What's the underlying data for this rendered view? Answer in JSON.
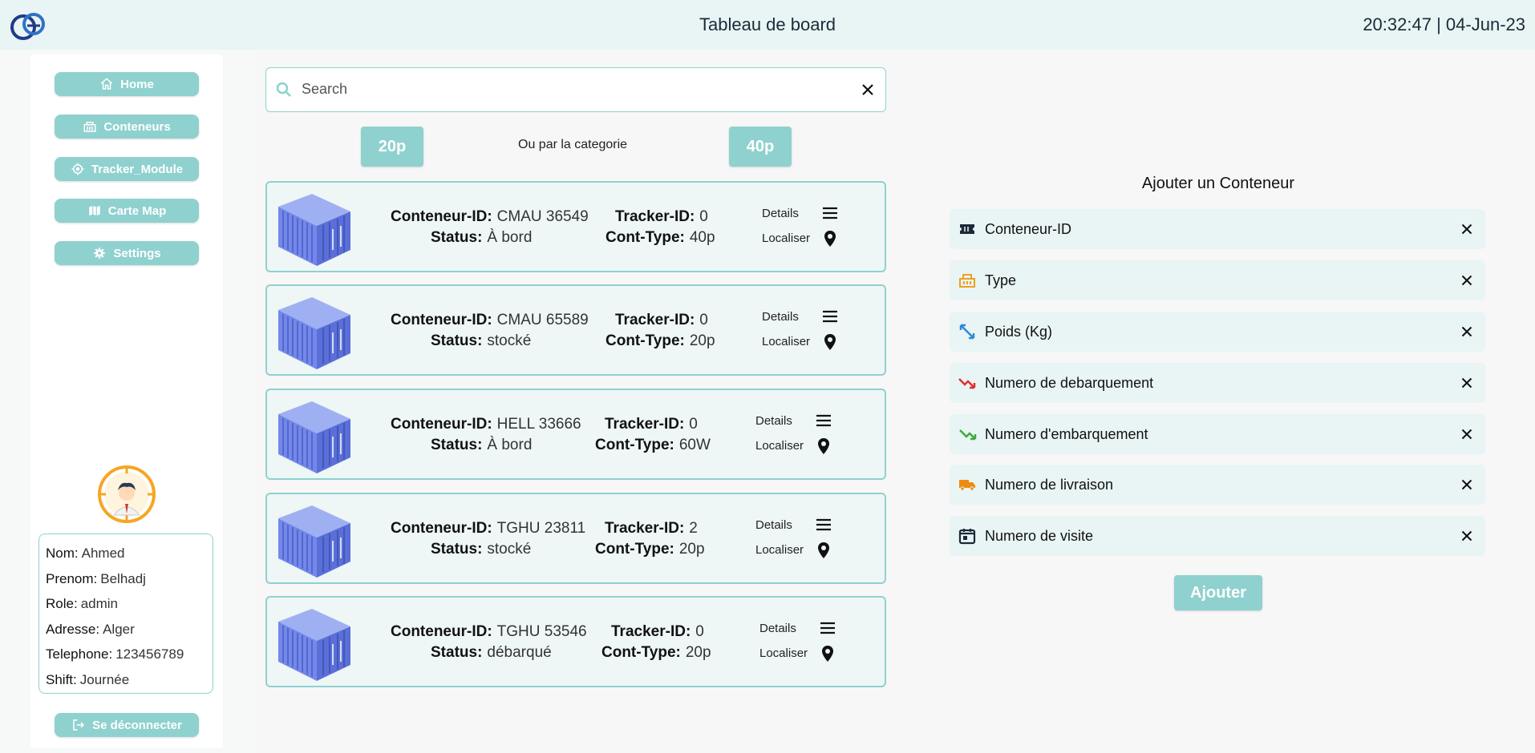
{
  "header": {
    "title": "Tableau de board",
    "time": "20:32:47",
    "separator": "|",
    "date": "04-Jun-23"
  },
  "sidebar": {
    "items": [
      {
        "label": "Home",
        "icon": "home-icon"
      },
      {
        "label": "Conteneurs",
        "icon": "container-icon"
      },
      {
        "label": "Tracker_Module",
        "icon": "tracker-icon"
      },
      {
        "label": "Carte Map",
        "icon": "map-icon"
      },
      {
        "label": "Settings",
        "icon": "gear-icon"
      }
    ],
    "profile": [
      {
        "key": "Nom:",
        "value": "Ahmed"
      },
      {
        "key": "Prenom:",
        "value": "Belhadj"
      },
      {
        "key": "Role:",
        "value": "admin"
      },
      {
        "key": "Adresse:",
        "value": "Alger"
      },
      {
        "key": "Telephone:",
        "value": "123456789"
      },
      {
        "key": "Shift:",
        "value": "Journée"
      }
    ],
    "logout_label": "Se déconnecter"
  },
  "search": {
    "placeholder": "Search"
  },
  "categories": {
    "btn1": "20p",
    "label": "Ou par la categorie",
    "btn2": "40p"
  },
  "labels": {
    "id": "Conteneur-ID:",
    "tracker": "Tracker-ID:",
    "status": "Status:",
    "type": "Cont-Type:",
    "details": "Details",
    "locate": "Localiser"
  },
  "containers": [
    {
      "id": "CMAU 36549",
      "tracker": "0",
      "status": "À bord",
      "type": "40p"
    },
    {
      "id": "CMAU 65589",
      "tracker": "0",
      "status": "stocké",
      "type": "20p"
    },
    {
      "id": "HELL 33666",
      "tracker": "0",
      "status": "À bord",
      "type": "60W"
    },
    {
      "id": "TGHU 23811",
      "tracker": "2",
      "status": "stocké",
      "type": "20p"
    },
    {
      "id": "TGHU 53546",
      "tracker": "0",
      "status": "débarqué",
      "type": "20p"
    }
  ],
  "form": {
    "title": "Ajouter un Conteneur",
    "fields": [
      {
        "label": "Conteneur-ID",
        "icon": "ticket-icon",
        "color": "#1c2a38"
      },
      {
        "label": "Type",
        "icon": "container-icon",
        "color": "#f0a020"
      },
      {
        "label": "Poids (Kg)",
        "icon": "resize-icon",
        "color": "#2a8ad8"
      },
      {
        "label": "Numero de debarquement",
        "icon": "trend-down-icon",
        "color": "#e03030"
      },
      {
        "label": "Numero d'embarquement",
        "icon": "trend-up-icon",
        "color": "#40a840"
      },
      {
        "label": "Numero de livraison",
        "icon": "truck-icon",
        "color": "#f08a10"
      },
      {
        "label": "Numero de visite",
        "icon": "calendar-icon",
        "color": "#1c2a38"
      }
    ],
    "submit_label": "Ajouter"
  },
  "colors": {
    "accent": "#8fd1cf",
    "header_bg": "#e9f4f4",
    "card_bg": "#eef6f6",
    "container_blue": "#6b80e6"
  }
}
